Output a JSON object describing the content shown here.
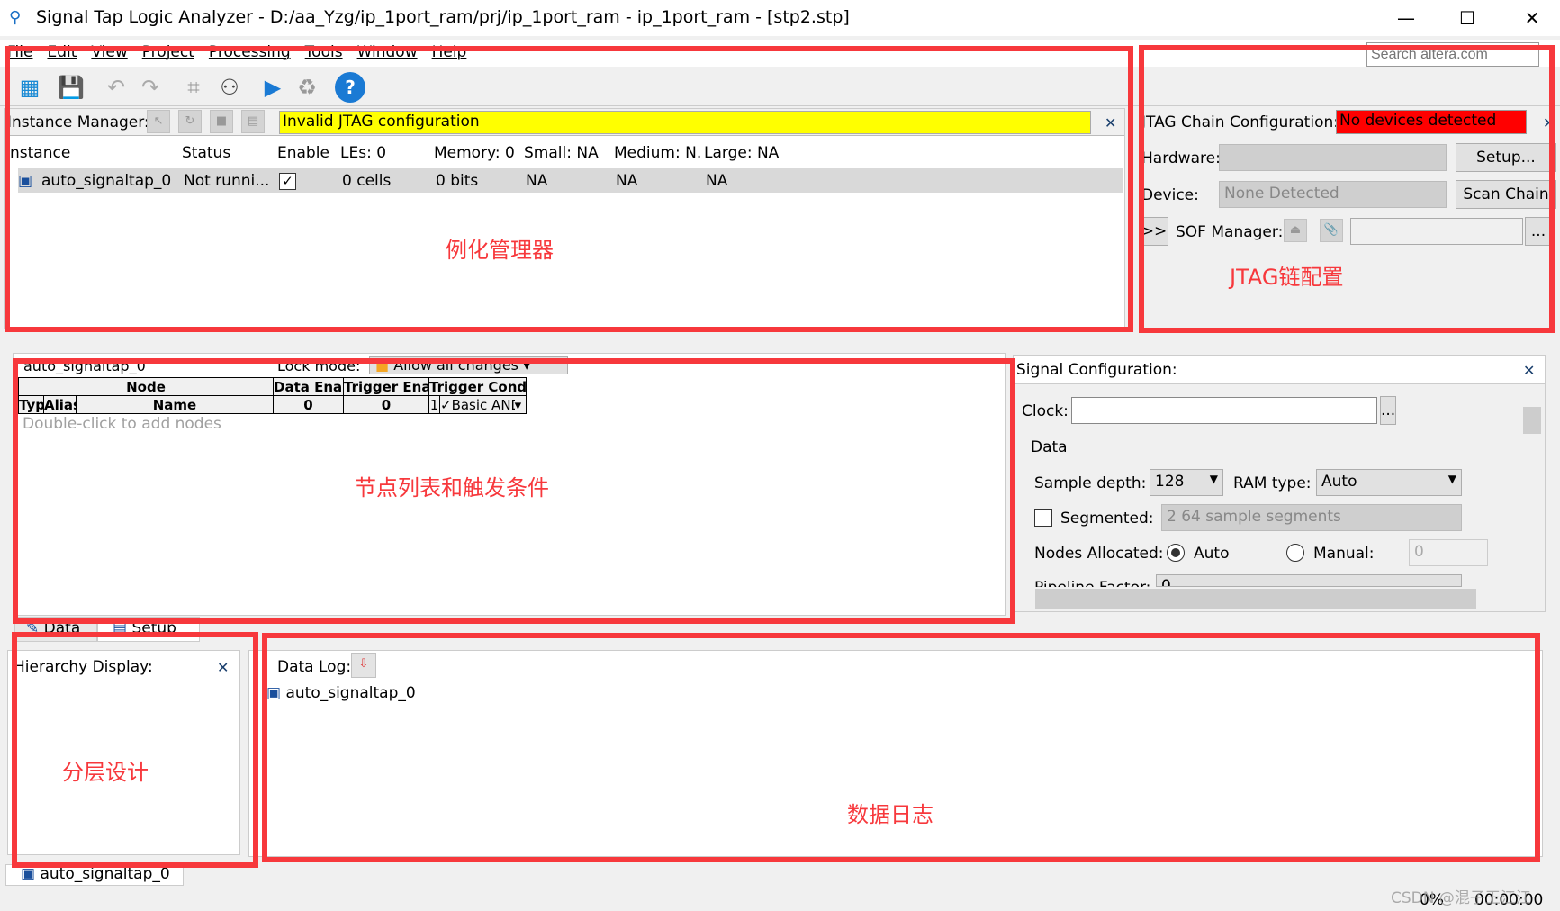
{
  "window": {
    "title": "Signal Tap Logic Analyzer - D:/aa_Yzg/ip_1port_ram/prj/ip_1port_ram - ip_1port_ram - [stp2.stp]",
    "minimize": "—",
    "maximize": "☐",
    "close": "✕"
  },
  "menu": [
    "File",
    "Edit",
    "View",
    "Project",
    "Processing",
    "Tools",
    "Window",
    "Help"
  ],
  "search": {
    "placeholder": "Search altera.com"
  },
  "instance_manager": {
    "label": "Instance Manager:",
    "status": "Invalid JTAG configuration",
    "status_color": "#ffff00",
    "columns": [
      "Instance",
      "Status",
      "Enable",
      "LEs: 0",
      "Memory: 0",
      "Small: NA",
      "Medium: N.",
      "Large: NA"
    ],
    "rows": [
      {
        "instance": "auto_signaltap_0",
        "status": "Not runni...",
        "enabled": true,
        "les": "0 cells",
        "memory": "0 bits",
        "small": "NA",
        "medium": "NA",
        "large": "NA"
      }
    ]
  },
  "jtag": {
    "label": "JTAG Chain Configuration:",
    "status": "No devices detected",
    "status_color": "#ff0000",
    "hardware_label": "Hardware:",
    "hardware_value": "",
    "setup": "Setup...",
    "device_label": "Device:",
    "device_value": "None Detected",
    "scan_chain": "Scan Chain",
    "expand": ">>",
    "sof_label": "SOF Manager:",
    "browse": "..."
  },
  "node_list": {
    "instance": "auto_signaltap_0",
    "lock_label": "Lock mode:",
    "lock_value": "Allow all changes",
    "group_node": "Node",
    "col_data_enable": "Data Enable",
    "col_trigger_enable": "Trigger Enable",
    "col_trigger_conditions": "Trigger Conditions",
    "col_type": "Type",
    "col_alias": "Alias",
    "col_name": "Name",
    "data_enable_count": "0",
    "trigger_enable_count": "0",
    "trigger_level": "1",
    "trigger_cond": "Basic AND",
    "placeholder": "Double-click to add nodes"
  },
  "tabs": [
    "Data",
    "Setup"
  ],
  "signal_config": {
    "title": "Signal Configuration:",
    "clock_label": "Clock:",
    "clock_value": "",
    "browse": "...",
    "data_group": "Data",
    "sample_depth_label": "Sample depth:",
    "sample_depth": "128",
    "ram_type_label": "RAM type:",
    "ram_type": "Auto",
    "segmented_label": "Segmented:",
    "segmented_checked": false,
    "segments": "2  64 sample segments",
    "nodes_allocated_label": "Nodes Allocated:",
    "auto_label": "Auto",
    "manual_label": "Manual:",
    "manual_value": "0",
    "nodes_mode": "Auto",
    "pipeline_label": "Pipeline Factor:",
    "pipeline_value": "0"
  },
  "hierarchy": {
    "title": "Hierarchy Display:"
  },
  "data_log": {
    "title": "Data Log:",
    "items": [
      "auto_signaltap_0"
    ]
  },
  "bottom_tab": "auto_signaltap_0",
  "status_bar": {
    "progress": "0%",
    "time": "00:00:00"
  },
  "watermark": "CSDN @混子王江江",
  "annotations": {
    "instance_manager": "例化管理器",
    "jtag": "JTAG链配置",
    "node_list": "节点列表和触发条件",
    "hierarchy": "分层设计",
    "data_log": "数据日志"
  }
}
